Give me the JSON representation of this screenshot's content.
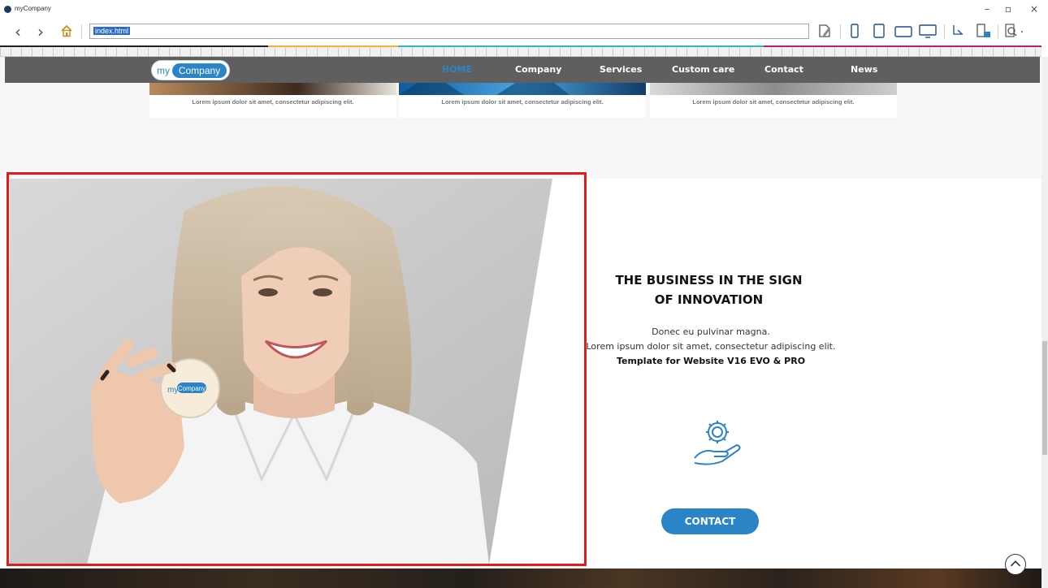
{
  "window": {
    "title": "myCompany",
    "minimize": "–",
    "maximize": "▫",
    "close": "×"
  },
  "toolbar": {
    "back": "‹",
    "forward": "›",
    "url": "index.html"
  },
  "site": {
    "brand_my": "my",
    "brand_company": "Company",
    "menu": [
      {
        "label": "HOME",
        "active": true
      },
      {
        "label": "Company"
      },
      {
        "label": "Services"
      },
      {
        "label": "Custom care"
      },
      {
        "label": "Contact"
      },
      {
        "label": "News"
      }
    ],
    "cards": [
      {
        "text": "Lorem ipsum dolor sit amet, consectetur adipiscing elit."
      },
      {
        "text": "Lorem ipsum dolor sit amet, consectetur adipiscing elit."
      },
      {
        "text": "Lorem ipsum dolor sit amet, consectetur adipiscing elit."
      }
    ]
  },
  "hero": {
    "title_line1": "THE BUSINESS IN THE SIGN",
    "title_line2": "OF INNOVATION",
    "line1": "Donec eu pulvinar magna.",
    "line2": "Lorem ipsum dolor sit amet, consectetur adipiscing elit.",
    "line3": "Template for Website V16 EVO & PRO",
    "contact_label": "CONTACT",
    "badge_my": "my",
    "badge_company": "Company"
  },
  "colors": {
    "accent": "#2a84c6",
    "nav_bg": "#5f5f5f",
    "selection": "#e21b1b"
  },
  "icons": {
    "home": "home-icon",
    "gear_hand": "gear-hand-icon",
    "back_top": "chevron-up-icon"
  }
}
